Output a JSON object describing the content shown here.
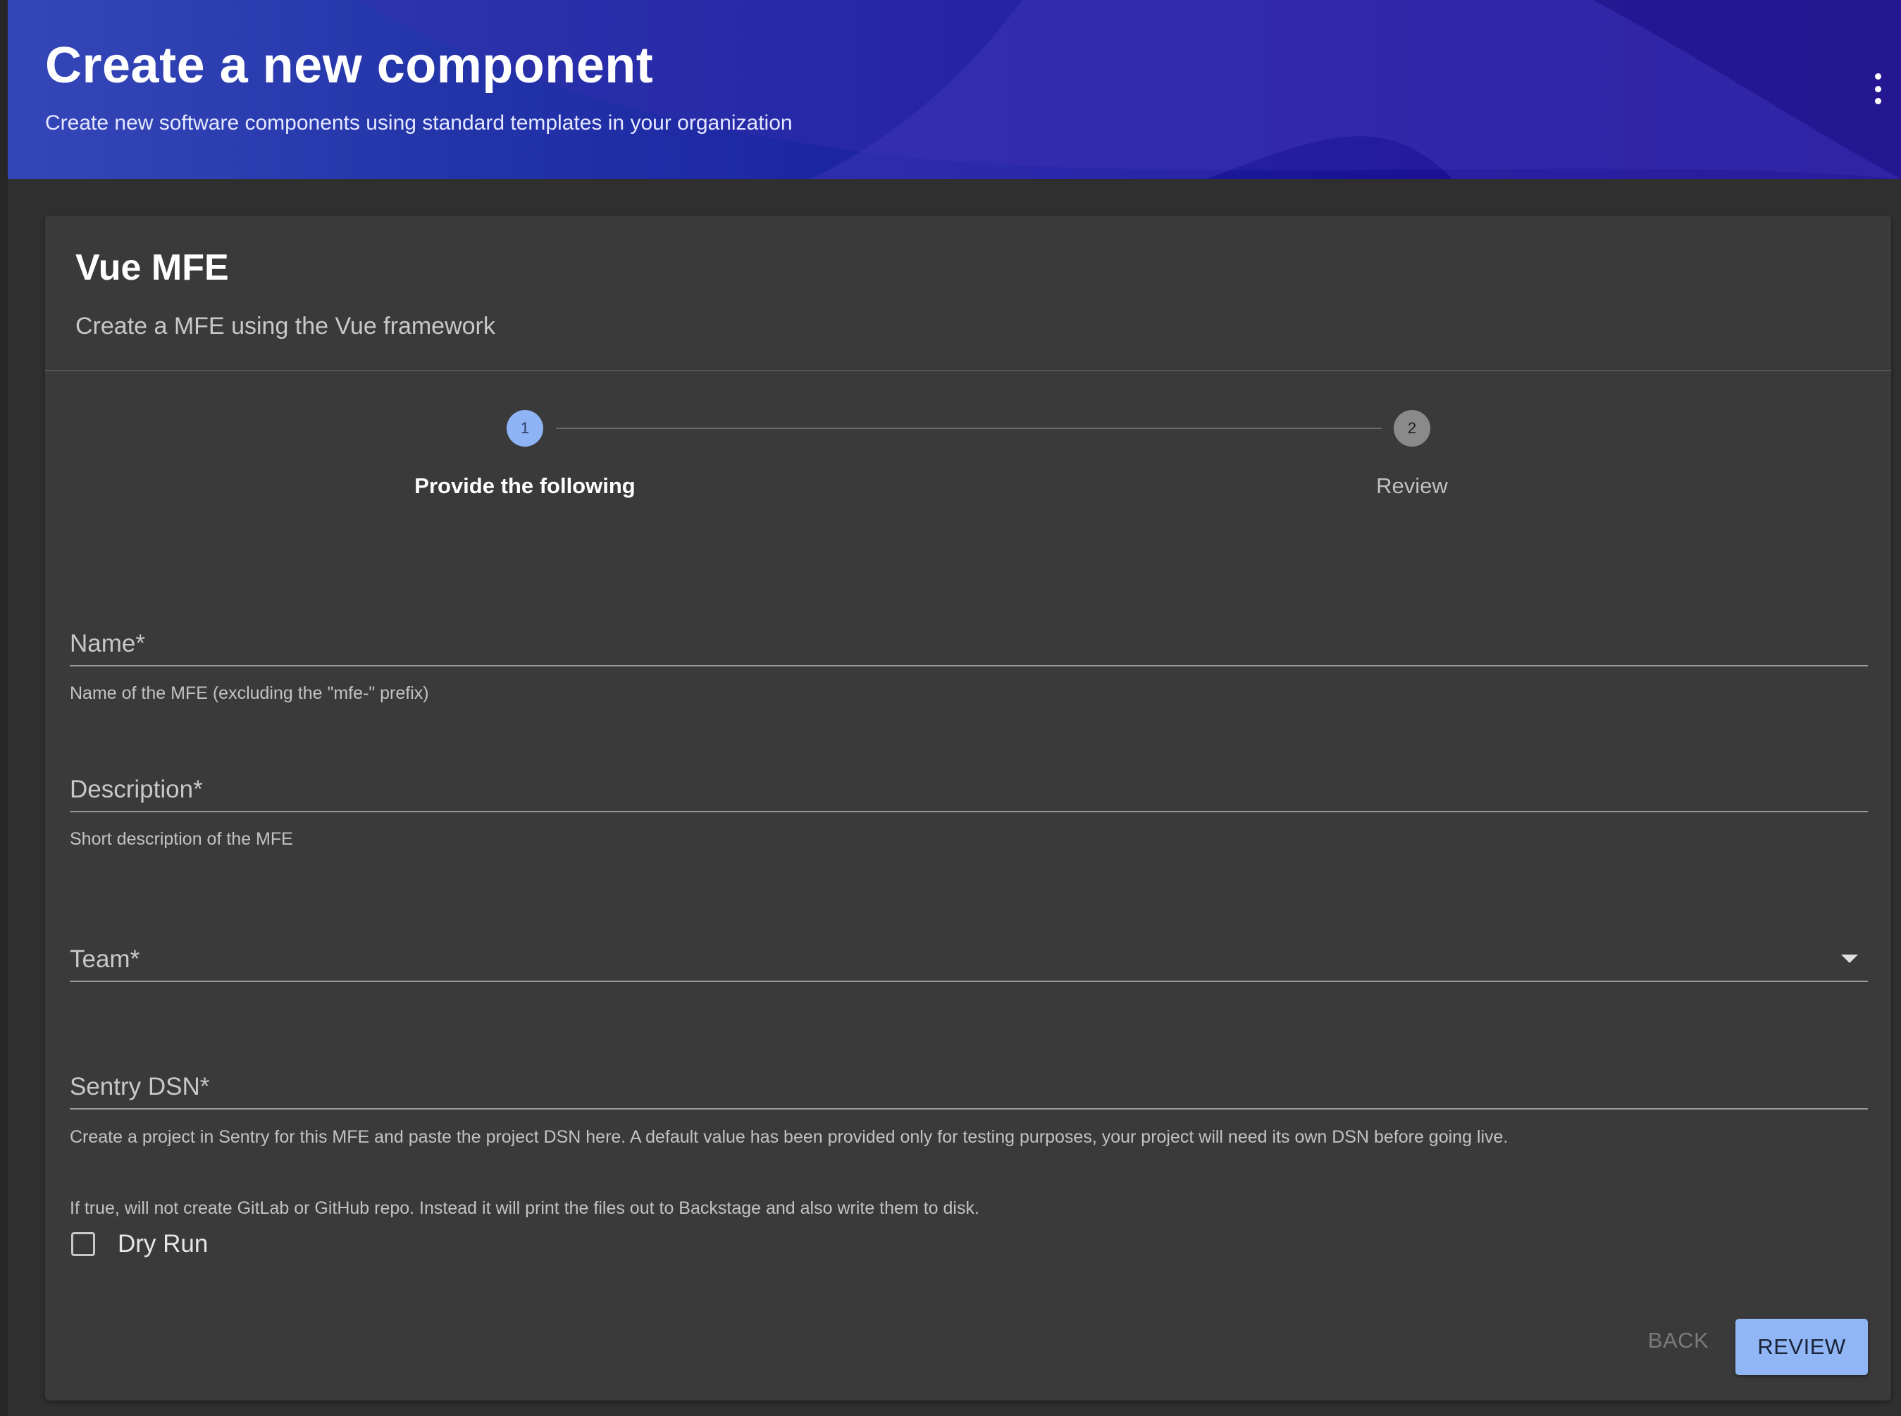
{
  "header": {
    "title": "Create a new component",
    "subtitle": "Create new software components using standard templates in your organization",
    "menu_icon": "more-vertical-icon"
  },
  "template": {
    "title": "Vue MFE",
    "description": "Create a MFE using the Vue framework"
  },
  "stepper": {
    "steps": [
      {
        "number": "1",
        "label": "Provide the following",
        "active": true
      },
      {
        "number": "2",
        "label": "Review",
        "active": false
      }
    ]
  },
  "form": {
    "name": {
      "label": "Name*",
      "value": "",
      "hint": "Name of the MFE (excluding the \"mfe-\" prefix)"
    },
    "description": {
      "label": "Description*",
      "value": "",
      "hint": "Short description of the MFE"
    },
    "team": {
      "label": "Team*",
      "value": "",
      "icon": "chevron-down-icon"
    },
    "sentry_dsn": {
      "label": "Sentry DSN*",
      "value": "",
      "hint": "Create a project in Sentry for this MFE and paste the project DSN here. A default value has been provided only for testing purposes, your project will need its own DSN before going live."
    },
    "dry_run": {
      "description": "If true, will not create GitLab or GitHub repo. Instead it will print the files out to Backstage and also write them to disk.",
      "label": "Dry Run",
      "checked": false
    }
  },
  "actions": {
    "back_label": "BACK",
    "review_label": "REVIEW"
  },
  "colors": {
    "accent": "#90b6f6",
    "header_gradient_start": "#3547b8",
    "header_gradient_end": "#16098a",
    "card_background": "#3a3a3a",
    "page_background": "#2f2f2f"
  }
}
